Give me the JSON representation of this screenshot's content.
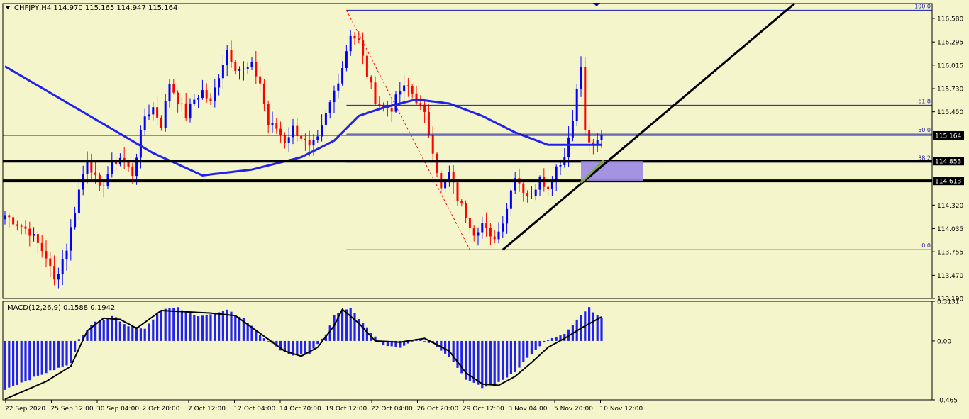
{
  "header": {
    "symbol": "CHFJPY,H4",
    "ohlc": "114.970 115.165 114.947 115.164"
  },
  "colors": {
    "background": "#f5f5cc",
    "bull": "#0000ff",
    "bear": "#ff0000",
    "ma": "#2222ee",
    "axis": "#000000",
    "fib": "#1a1aa8",
    "zone": "#9b88e6",
    "macd_hist": "#2222ee",
    "macd_signal": "#000000"
  },
  "chart_data": [
    {
      "type": "candlestick",
      "title": "CHFJPY,H4",
      "ylim": [
        113.19,
        116.76
      ],
      "y_ticks": [
        "116.580",
        "116.295",
        "116.015",
        "115.730",
        "115.450",
        "115.164",
        "114.853",
        "114.613",
        "114.320",
        "114.035",
        "113.755",
        "113.470",
        "113.190"
      ],
      "x_ticks": [
        "22 Sep 2020",
        "25 Sep 12:00",
        "30 Sep 04:00",
        "2 Oct 20:00",
        "7 Oct 12:00",
        "12 Oct 04:00",
        "14 Oct 20:00",
        "19 Oct 12:00",
        "22 Oct 04:00",
        "26 Oct 20:00",
        "29 Oct 12:00",
        "3 Nov 04:00",
        "5 Nov 20:00",
        "10 Nov 12:00"
      ],
      "price_markers": [
        {
          "label": "115.164",
          "value": 115.164
        },
        {
          "label": "114.853",
          "value": 114.853
        },
        {
          "label": "114.613",
          "value": 114.613
        }
      ],
      "fibonacci": [
        {
          "label": "100.0",
          "value": 116.68
        },
        {
          "label": "61.8",
          "value": 115.53
        },
        {
          "label": "50.0",
          "value": 115.18
        },
        {
          "label": "38.2",
          "value": 114.84
        },
        {
          "label": "0.0",
          "value": 113.78
        }
      ],
      "horizontal_lines": [
        114.853,
        114.613
      ],
      "current_price": 115.164,
      "close_path": [
        [
          0,
          114.2
        ],
        [
          6,
          114.0
        ],
        [
          10,
          113.7
        ],
        [
          12,
          113.4
        ],
        [
          15,
          113.8
        ],
        [
          18,
          114.5
        ],
        [
          20,
          114.9
        ],
        [
          23,
          114.5
        ],
        [
          26,
          114.8
        ],
        [
          28,
          114.9
        ],
        [
          31,
          114.7
        ],
        [
          34,
          115.4
        ],
        [
          36,
          115.5
        ],
        [
          38,
          115.3
        ],
        [
          40,
          115.8
        ],
        [
          44,
          115.4
        ],
        [
          46,
          115.6
        ],
        [
          48,
          115.7
        ],
        [
          50,
          115.55
        ],
        [
          52,
          115.9
        ],
        [
          54,
          116.2
        ],
        [
          56,
          116.0
        ],
        [
          58,
          115.95
        ],
        [
          60,
          116.0
        ],
        [
          62,
          115.8
        ],
        [
          64,
          115.3
        ],
        [
          66,
          115.25
        ],
        [
          68,
          115.1
        ],
        [
          70,
          115.25
        ],
        [
          72,
          115.15
        ],
        [
          74,
          115.0
        ],
        [
          76,
          115.1
        ],
        [
          78,
          115.4
        ],
        [
          80,
          115.7
        ],
        [
          82,
          116.0
        ],
        [
          84,
          116.4
        ],
        [
          86,
          116.3
        ],
        [
          88,
          115.9
        ],
        [
          90,
          115.6
        ],
        [
          92,
          115.5
        ],
        [
          94,
          115.5
        ],
        [
          96,
          115.7
        ],
        [
          98,
          115.75
        ],
        [
          100,
          115.6
        ],
        [
          102,
          115.4
        ],
        [
          104,
          115.0
        ],
        [
          106,
          114.5
        ],
        [
          108,
          114.7
        ],
        [
          110,
          114.4
        ],
        [
          112,
          114.2
        ],
        [
          114,
          114.0
        ],
        [
          116,
          114.1
        ],
        [
          118,
          113.9
        ],
        [
          120,
          114.0
        ],
        [
          122,
          114.3
        ],
        [
          124,
          114.7
        ],
        [
          126,
          114.5
        ],
        [
          128,
          114.4
        ],
        [
          130,
          114.7
        ],
        [
          132,
          114.5
        ],
        [
          134,
          114.8
        ],
        [
          136,
          114.9
        ],
        [
          138,
          115.4
        ],
        [
          140,
          116.0
        ],
        [
          141,
          115.2
        ],
        [
          143,
          115.0
        ],
        [
          145,
          115.164
        ]
      ],
      "series": [
        {
          "name": "MA",
          "values": [
            [
              0,
              116.0
            ],
            [
              12,
              115.65
            ],
            [
              24,
              115.3
            ],
            [
              36,
              114.95
            ],
            [
              48,
              114.68
            ],
            [
              60,
              114.75
            ],
            [
              72,
              114.9
            ],
            [
              80,
              115.1
            ],
            [
              86,
              115.4
            ],
            [
              92,
              115.5
            ],
            [
              100,
              115.6
            ],
            [
              108,
              115.55
            ],
            [
              116,
              115.4
            ],
            [
              124,
              115.2
            ],
            [
              132,
              115.05
            ],
            [
              138,
              115.05
            ],
            [
              145,
              115.05
            ]
          ]
        }
      ]
    },
    {
      "type": "bar",
      "title": "MACD(12,26,9) 0.1588 0.1942",
      "ylim": [
        -0.465,
        0.313
      ],
      "y_ticks": [
        "0.3131",
        "0.00",
        "-0.465"
      ],
      "histogram_points": [
        [
          0,
          -0.38
        ],
        [
          10,
          -0.25
        ],
        [
          16,
          -0.18
        ],
        [
          18,
          0.02
        ],
        [
          22,
          0.15
        ],
        [
          26,
          0.2
        ],
        [
          30,
          0.12
        ],
        [
          34,
          0.1
        ],
        [
          38,
          0.25
        ],
        [
          42,
          0.26
        ],
        [
          46,
          0.2
        ],
        [
          50,
          0.21
        ],
        [
          54,
          0.24
        ],
        [
          58,
          0.18
        ],
        [
          62,
          0.05
        ],
        [
          66,
          -0.05
        ],
        [
          70,
          -0.12
        ],
        [
          74,
          -0.1
        ],
        [
          78,
          0.05
        ],
        [
          80,
          0.2
        ],
        [
          84,
          0.26
        ],
        [
          88,
          0.1
        ],
        [
          92,
          -0.03
        ],
        [
          96,
          -0.05
        ],
        [
          100,
          0.02
        ],
        [
          104,
          -0.02
        ],
        [
          108,
          -0.12
        ],
        [
          112,
          -0.3
        ],
        [
          116,
          -0.37
        ],
        [
          120,
          -0.33
        ],
        [
          124,
          -0.24
        ],
        [
          128,
          -0.1
        ],
        [
          132,
          0.01
        ],
        [
          136,
          0.05
        ],
        [
          140,
          0.2
        ],
        [
          142,
          0.26
        ],
        [
          145,
          0.18
        ]
      ],
      "signal_points": [
        [
          0,
          -0.46
        ],
        [
          10,
          -0.32
        ],
        [
          16,
          -0.2
        ],
        [
          20,
          0.08
        ],
        [
          24,
          0.18
        ],
        [
          28,
          0.17
        ],
        [
          32,
          0.1
        ],
        [
          38,
          0.24
        ],
        [
          44,
          0.23
        ],
        [
          50,
          0.22
        ],
        [
          56,
          0.2
        ],
        [
          62,
          0.06
        ],
        [
          68,
          -0.08
        ],
        [
          72,
          -0.12
        ],
        [
          76,
          -0.05
        ],
        [
          80,
          0.12
        ],
        [
          82,
          0.25
        ],
        [
          86,
          0.14
        ],
        [
          90,
          0.0
        ],
        [
          96,
          -0.01
        ],
        [
          102,
          0.02
        ],
        [
          108,
          -0.08
        ],
        [
          112,
          -0.25
        ],
        [
          116,
          -0.34
        ],
        [
          120,
          -0.35
        ],
        [
          124,
          -0.28
        ],
        [
          128,
          -0.17
        ],
        [
          132,
          -0.05
        ],
        [
          136,
          0.02
        ],
        [
          140,
          0.1
        ],
        [
          145,
          0.19
        ]
      ]
    }
  ]
}
